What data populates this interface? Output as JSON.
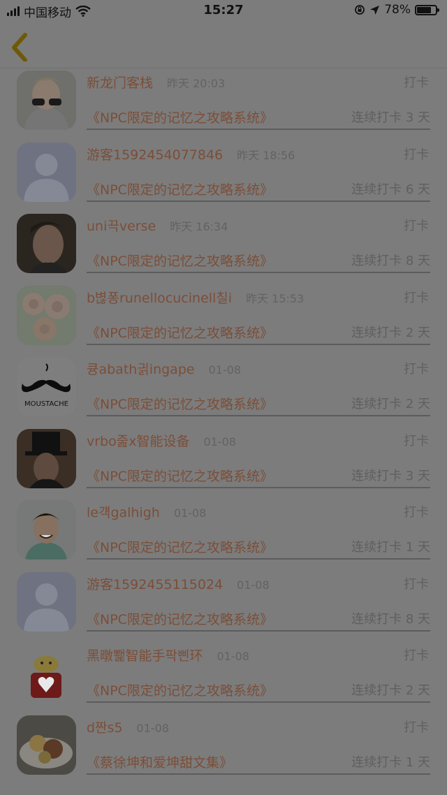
{
  "status_bar": {
    "carrier": "中国移动",
    "time": "15:27",
    "battery_text": "78%",
    "battery_level": 0.78
  },
  "rows": [
    {
      "name": "新龙门客栈",
      "time": "昨天 20:03",
      "action": "打卡",
      "book": "《NPC限定的记忆之攻略系统》",
      "streak": "连续打卡 3 天",
      "avatar": "photo-boy-glasses"
    },
    {
      "name": "游客1592454077846",
      "time": "昨天 18:56",
      "action": "打卡",
      "book": "《NPC限定的记忆之攻略系统》",
      "streak": "连续打卡 6 天",
      "avatar": "default-person"
    },
    {
      "name": "uni끅verse",
      "time": "昨天 16:34",
      "action": "打卡",
      "book": "《NPC限定的记忆之攻略系统》",
      "streak": "连续打卡 8 天",
      "avatar": "photo-man-portrait"
    },
    {
      "name": "b볂퐁runellocucinell칠i",
      "time": "昨天 15:53",
      "action": "打卡",
      "book": "《NPC限定的记忆之攻略系统》",
      "streak": "连续打卡 2 天",
      "avatar": "photo-roses"
    },
    {
      "name": "큥abath긝ingape",
      "time": "01-08",
      "action": "打卡",
      "book": "《NPC限定的记忆之攻略系统》",
      "streak": "连续打卡 2 天",
      "avatar": "moustache-logo"
    },
    {
      "name": "vrbo줊x智能设备",
      "time": "01-08",
      "action": "打卡",
      "book": "《NPC限定的记忆之攻略系统》",
      "streak": "连续打卡 3 天",
      "avatar": "photo-top-hat"
    },
    {
      "name": "le걕galhigh",
      "time": "01-08",
      "action": "打卡",
      "book": "《NPC限定的记忆之攻略系统》",
      "streak": "连续打卡 1 天",
      "avatar": "photo-smiling-man"
    },
    {
      "name": "游客1592455115024",
      "time": "01-08",
      "action": "打卡",
      "book": "《NPC限定的记忆之攻略系统》",
      "streak": "连续打卡 8 天",
      "avatar": "default-person"
    },
    {
      "name": "黑暾뾅智能手팍삔环",
      "time": "01-08",
      "action": "打卡",
      "book": "《NPC限定的记忆之攻略系统》",
      "streak": "连续打卡 2 天",
      "avatar": "cartoon-heart"
    },
    {
      "name": "d짠s5",
      "time": "01-08",
      "action": "打卡",
      "book": "《蔡徐坤和爱坤甜文集》",
      "streak": "连续打卡 1 天",
      "avatar": "photo-food"
    }
  ]
}
